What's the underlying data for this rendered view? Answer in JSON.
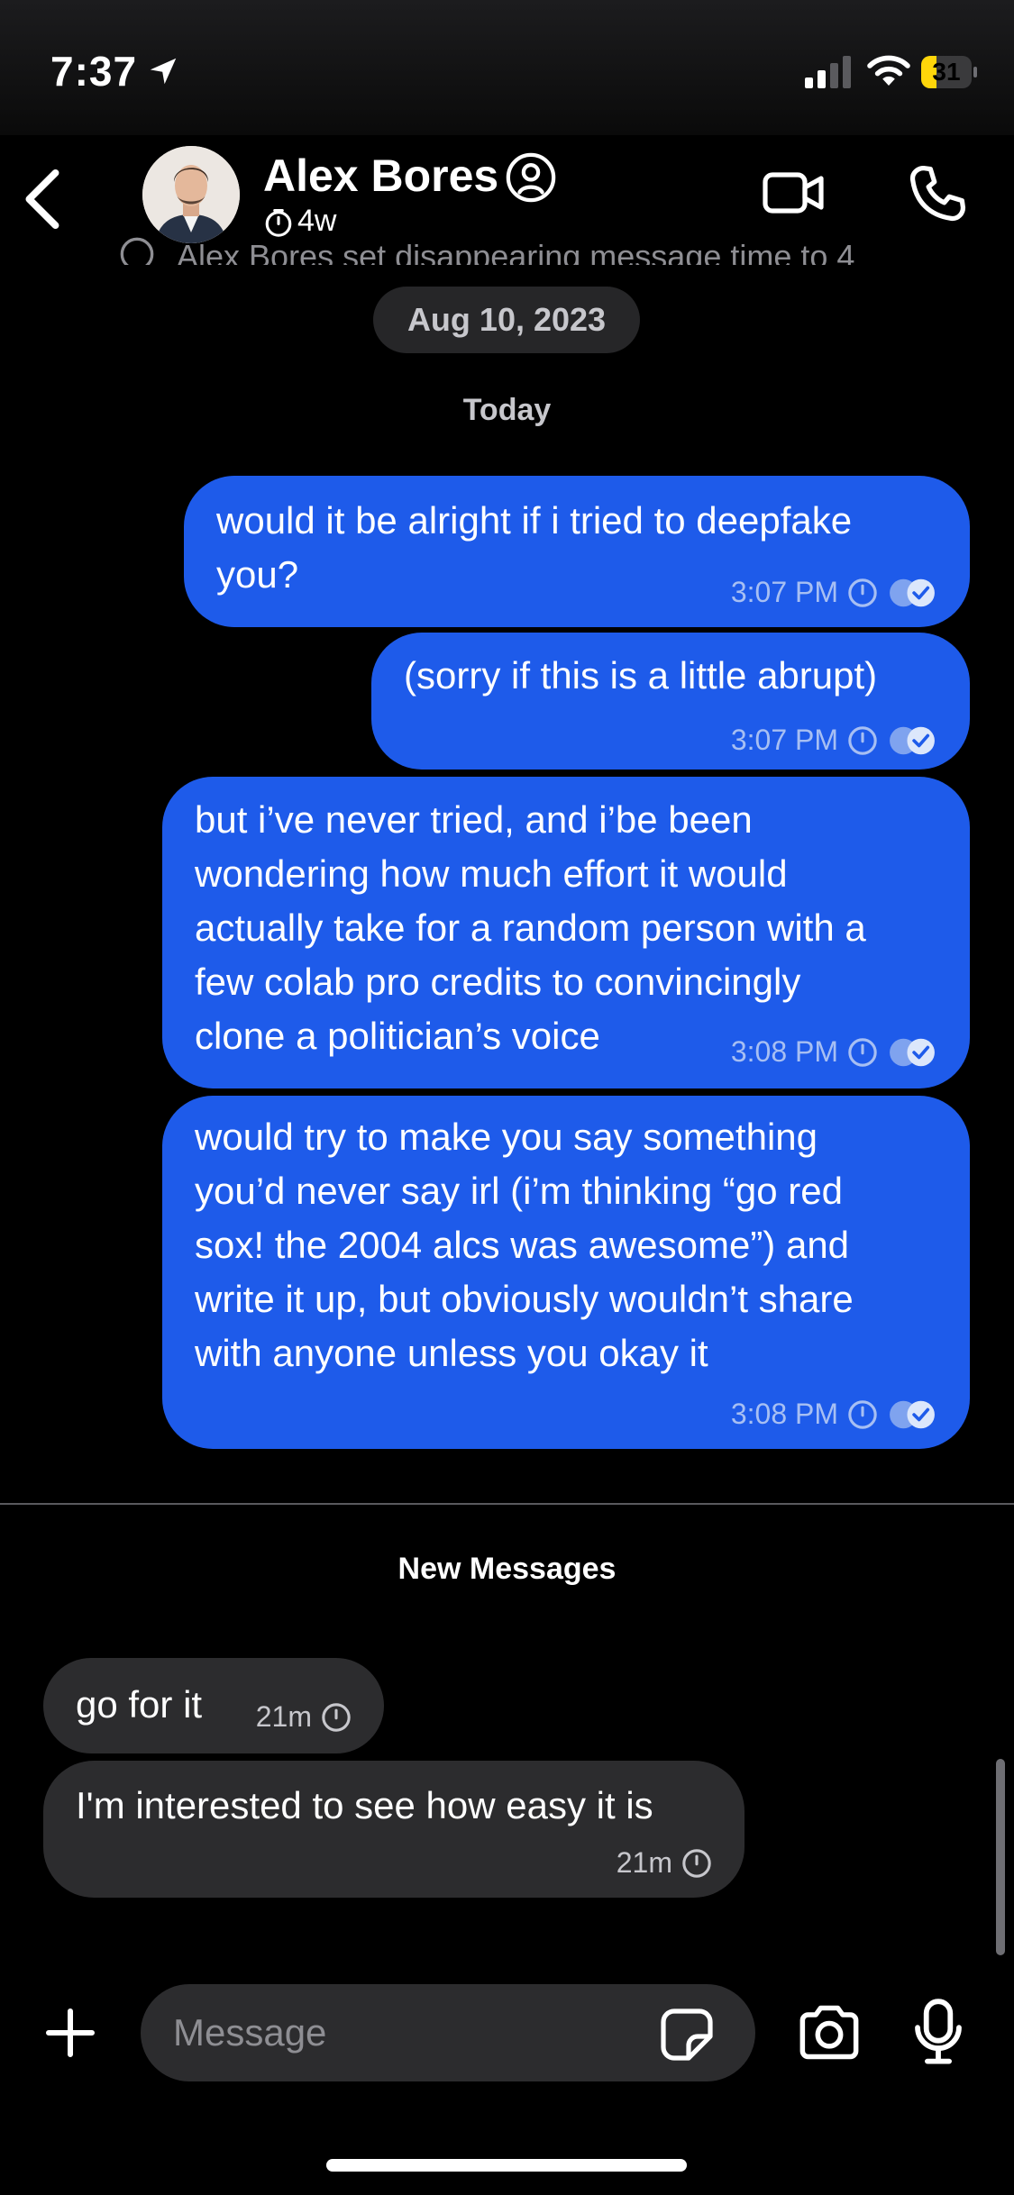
{
  "status_bar": {
    "time": "7:37",
    "battery": "31",
    "battery_level": 0.31
  },
  "header": {
    "name": "Alex Bores",
    "disappearing_timer": "4w",
    "system_message": "Alex Bores set disappearing message time to 4"
  },
  "conversation": {
    "date_label": "Aug 10, 2023",
    "day_label": "Today",
    "new_messages_label": "New Messages",
    "outgoing": [
      {
        "lines": [
          "would it be alright if i tried to deepfake",
          "you?"
        ],
        "time": "3:07 PM"
      },
      {
        "lines": [
          "(sorry if this is a little abrupt)"
        ],
        "time": "3:07 PM"
      },
      {
        "lines": [
          "but i’ve never tried, and i’be been",
          "wondering how much effort it would",
          "actually take for a random person with a",
          "few colab pro credits to convincingly",
          "clone a politician’s voice"
        ],
        "time": "3:08 PM"
      },
      {
        "lines": [
          "would try to make you say something",
          "you’d never say irl (i’m thinking “go red",
          "sox! the 2004 alcs was awesome”) and",
          "write it up, but obviously wouldn’t share",
          "with anyone unless you okay it"
        ],
        "time": "3:08 PM"
      }
    ],
    "incoming": [
      {
        "text": "go for it",
        "time": "21m"
      },
      {
        "text": "I'm interested to see how easy it is",
        "time": "21m"
      }
    ]
  },
  "composer": {
    "placeholder": "Message"
  },
  "icons": {
    "back": "chevron-left-icon",
    "profile": "profile-circle-icon",
    "video": "video-camera-icon",
    "phone": "phone-icon",
    "timer": "timer-icon",
    "read": "double-check-icon",
    "plus": "plus-icon",
    "sticker": "sticker-icon",
    "camera": "camera-icon",
    "mic": "microphone-icon"
  },
  "colors": {
    "outgoing_bubble": "#1e5bea",
    "incoming_bubble": "#2c2c2e",
    "battery": "#ffd60a"
  }
}
